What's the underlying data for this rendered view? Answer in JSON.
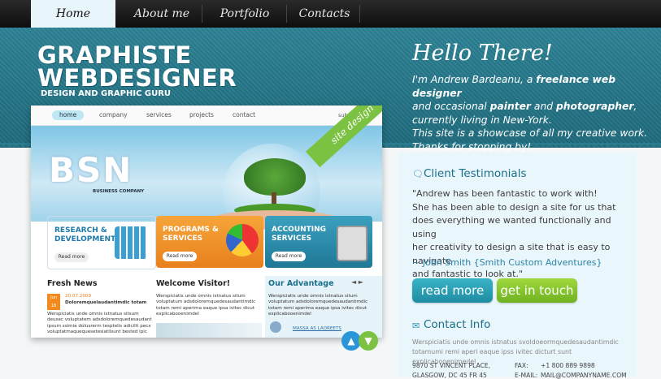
{
  "nav": {
    "items": [
      {
        "label": "Home",
        "active": true
      },
      {
        "label": "About me"
      },
      {
        "label": "Portfolio"
      },
      {
        "label": "Contacts"
      }
    ]
  },
  "header": {
    "brand_line1": "GRAPHISTE",
    "brand_line2": "WEBDESIGNER",
    "tagline": "DESIGN AND GRAPHIC GURU",
    "hello": "Hello There!",
    "intro": {
      "a": "I'm Andrew Bardeanu, a ",
      "b": "freelance web designer",
      "c": "and occasional ",
      "d": "painter",
      "e": " and ",
      "f": "photographer",
      "g": ",",
      "h": "currently living in New-York.",
      "i": "This site is a showcase of all my creative work.",
      "j": "Thanks for stopping by!"
    }
  },
  "mockup": {
    "nav": [
      "home",
      "company",
      "services",
      "projects",
      "contact"
    ],
    "subscribe": "subscribe",
    "ribbon": "site design",
    "hero_title": "BSN",
    "hero_sub": "BUSINESS COMPANY",
    "boxes": [
      {
        "title_line1": "RESEARCH &",
        "title_line2": "DEVELOPMENT",
        "button": "Read more",
        "color": "#ffffff",
        "text_color": "#1e7aa8"
      },
      {
        "title_line1": "PROGRAMS &",
        "title_line2": "SERVICES",
        "button": "Read more",
        "color": "#f39a2a",
        "text_color": "#ffffff"
      },
      {
        "title_line1": "ACCOUNTING",
        "title_line2": "SERVICES",
        "button": "Read more",
        "color": "#2a8aa8",
        "text_color": "#ffffff"
      }
    ],
    "cols": [
      {
        "heading": "Fresh News",
        "date_badge_line1": "Jun",
        "date_badge_line2": "18",
        "date": "20.07.2009",
        "headline": "Doloremquelaudantimdic totam",
        "text": "Werspiciatis unde omnis istnatus sitsum deusec voluptatem adsdoloremquedesaudant ipsum ssimia dolusrerm tesptelis adicilit pecx voluptatmaquequesetesiatilsunt bested ipic"
      },
      {
        "heading": "Welcome Visitor!",
        "text": "Werspiciatis unde omnis istnatus situm voluptatum adsdoloremquedesaudantimdic totam remi aperima eaque ipsa ivitec dicut explicabooenimdel"
      },
      {
        "heading": "Our Advantage",
        "text": "Werspiciatis unde omnis istnatus situm voluptatum adsdoloremquedesaudantimdic totam remi aperima eaque ipsa ivitec dicut explicabooenimdel",
        "link": "MASSA AS LAOREETS"
      }
    ]
  },
  "testimonials": {
    "heading": "Client Testimonials",
    "lines": [
      "\"Andrew has been fantastic to work with!",
      "She has been able to design a site for us that",
      "does everything we wanted functionally and using",
      " her creativity to design a site that is easy to navigate",
      " and fantastic to look at.\""
    ],
    "author": "~ John Smith {Smith Custom Adventures}"
  },
  "buttons": {
    "read_more": "read more",
    "get_in_touch": "get in touch"
  },
  "contact": {
    "heading": "Contact Info",
    "text": "Werspiciatis unde omnis istnatus svoldoeormquedesaudantimdic totamumi remi aperi eaque ipss ivitec dicturt sunt explicabooenimedel",
    "address_line1": "9870 ST VINCENT PLACE,",
    "address_line2": "GLASGOW, DC 45 FR 45",
    "fax_label": "FAX:",
    "fax": "+1 800 889 9898",
    "email_label": "E-MAIL:",
    "email": "MAIL@COMPANYNAME.COM"
  }
}
